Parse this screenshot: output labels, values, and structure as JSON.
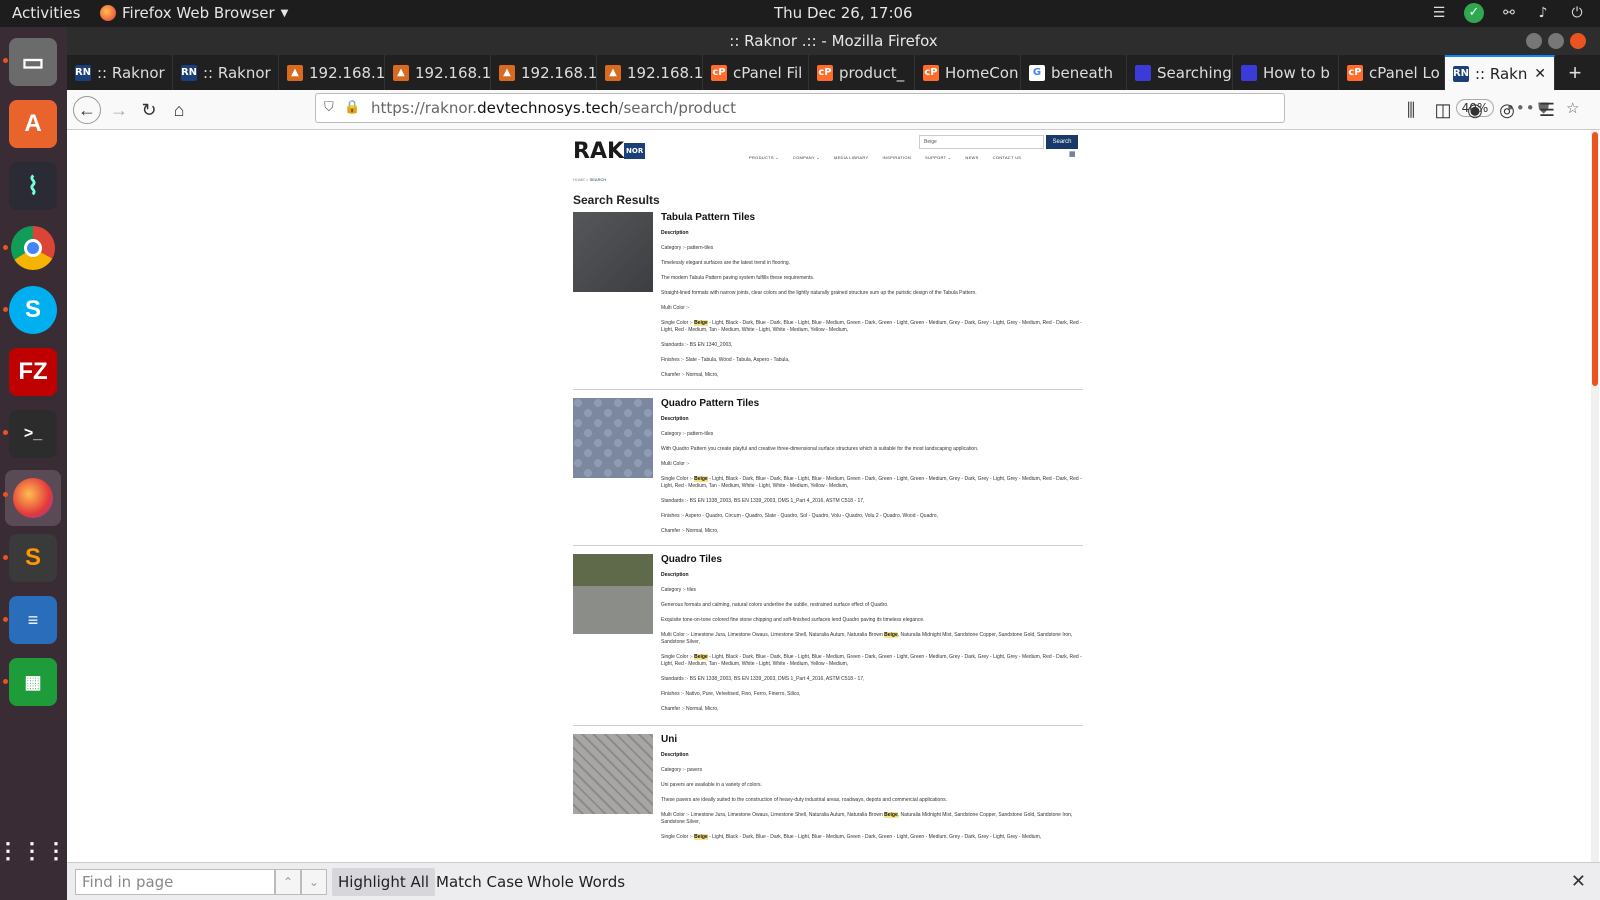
{
  "system": {
    "activities": "Activities",
    "app_menu": "Firefox Web Browser",
    "clock": "Thu Dec 26, 17:06"
  },
  "window": {
    "title": ":: Raknor .:: - Mozilla Firefox"
  },
  "tabs": [
    {
      "label": ":: Raknor",
      "icon": "raknor-icon"
    },
    {
      "label": ":: Raknor",
      "icon": "raknor-icon"
    },
    {
      "label": "192.168.1",
      "icon": "server-icon"
    },
    {
      "label": "192.168.1",
      "icon": "server-icon"
    },
    {
      "label": "192.168.1",
      "icon": "server-icon"
    },
    {
      "label": "192.168.1",
      "icon": "server-icon"
    },
    {
      "label": "cPanel Fil",
      "icon": "cpanel-icon"
    },
    {
      "label": "product_",
      "icon": "cpanel-icon"
    },
    {
      "label": "HomeCon",
      "icon": "cpanel-icon"
    },
    {
      "label": "beneath",
      "icon": "google-icon"
    },
    {
      "label": "Searching",
      "icon": "page-icon"
    },
    {
      "label": "How to b",
      "icon": "page-icon"
    },
    {
      "label": "cPanel Lo",
      "icon": "cpanel-icon"
    },
    {
      "label": ":: Rakn",
      "icon": "raknor-icon",
      "active": true
    }
  ],
  "nav": {
    "url_prefix": "https://raknor.",
    "url_domain": "devtechnosys.tech",
    "url_path": "/search/product",
    "zoom": "40%"
  },
  "site": {
    "logo_text": "RAK",
    "logo_badge": "NOR",
    "search_value": "Beige",
    "search_button": "Search",
    "menu": [
      "PRODUCTS ⌄",
      "COMPANY ⌄",
      "MEDIA LIBRARY",
      "INSPIRATION",
      "SUPPORT ⌄",
      "NEWS",
      "CONTACT US"
    ],
    "breadcrumb_home": "HOME",
    "breadcrumb_sep": ">",
    "breadcrumb_current": "SEARCH",
    "heading": "Search Results",
    "results": [
      {
        "title": "Tabula Pattern Tiles",
        "description_label": "Description",
        "category": "Category :- pattern-tiles",
        "texts": [
          "Timelessly elegant surfaces are the latest trend in flooring.",
          "The modern Tabula Pattern paving system fulfills these requirements.",
          "Straight-lined formats with narrow joints, clear colors and the lightly naturally grained structure sum up the puristic design of the Tabula Pattern."
        ],
        "multi_color": "Multi Color :-",
        "single_color_prefix": "Single Color :-",
        "single_color_hl": "Beige",
        "single_color_rest": "- Light, Black - Dark, Blue - Dark, Blue - Light, Blue - Medium, Green - Dark, Green - Light, Green - Medium, Grey - Dark, Grey - Light, Grey - Medium, Red - Dark, Red - Light, Red - Medium, Tan - Medium, White - Light, White - Medium, Yellow - Medium,",
        "standards": "Standards :- BS EN 1340_2003,",
        "finishes": "Finishes :- Slate - Tabula, Wood - Tabula, Aspero - Tabula,",
        "chamfer": "Chamfer :- Normal, Micro,"
      },
      {
        "title": "Quadro Pattern Tiles",
        "description_label": "Description",
        "category": "Category :- pattern-tiles",
        "texts": [
          "With Quadro Pattern you create playful and creative three-dimensional surface structures which is suitable for the most landscaping application."
        ],
        "multi_color": "Multi Color :-",
        "single_color_prefix": "Single Color :-",
        "single_color_hl": "Beige",
        "single_color_rest": "- Light, Black - Dark, Blue - Dark, Blue - Light, Blue - Medium, Green - Dark, Green - Light, Green - Medium, Grey - Dark, Grey - Light, Grey - Medium, Red - Dark, Red - Light, Red - Medium, Tan - Medium, White - Light, White - Medium, Yellow - Medium,",
        "standards": "Standards :- BS EN 1338_2003, BS EN 1339_2003, DMS 1_Part 4_2016, ASTM C518 - 17,",
        "finishes": "Finishes :- Aspero - Quadro, Circum - Quadro, Slate - Quadro, Sol - Quadro, Volu - Quadro, Volu 2 - Quadro, Wood - Quadro,",
        "chamfer": "Chamfer :- Normal, Micro,"
      },
      {
        "title": "Quadro Tiles",
        "description_label": "Description",
        "category": "Category :- tiles",
        "texts": [
          "Generous formats and calming, natural colors underline the subtle, restrained surface effect of Quadro.",
          "Exquisite tone-on-tone colored fine stone chipping and soft-finished surfaces lend Quadro paving its timeless elegance."
        ],
        "multi_color": "Multi Color :- Limestone Jura, Limestone Owaus, Limestone Shell, Naturalia Autum, Naturalia Brown",
        "multi_color_hl": "Beige",
        "multi_color_rest": ", Naturalia Midnight Mist, Sandstone Copper, Sandstone Gold, Sandstone Iron, Sandstone Silver,",
        "single_color_prefix": "Single Color :-",
        "single_color_hl": "Beige",
        "single_color_rest": "- Light, Black - Dark, Blue - Dark, Blue - Light, Blue - Medium, Green - Dark, Green - Light, Green - Medium, Grey - Dark, Grey - Light, Grey - Medium, Red - Dark, Red - Light, Red - Medium, Tan - Medium, White - Light, White - Medium, Yellow - Medium,",
        "standards": "Standards :- BS EN 1338_2003, BS EN 1339_2003, DMS 1_Part 4_2016, ASTM C518 - 17,",
        "finishes": "Finishes :- Nativo, Pure, Velvetised, Fino, Ferro, Finerro, Silico,",
        "chamfer": "Chamfer :- Normal, Micro,"
      },
      {
        "title": "Uni",
        "description_label": "Description",
        "category": "Category :- pavers",
        "texts": [
          "Uni pavers are available in a variety of colors.",
          "These pavers are ideally suited to the construction of heavy-duty industrial areas, roadways, depots and commercial applications."
        ],
        "multi_color": "Multi Color :- Limestone Jura, Limestone Owaus, Limestone Shell, Naturalia Autum, Naturalia Brown",
        "multi_color_hl": "Beige",
        "multi_color_rest": ", Naturalia Midnight Mist, Sandstone Copper, Sandstone Gold, Sandstone Iron, Sandstone Silver,",
        "single_color_prefix": "Single Color :-",
        "single_color_hl": "Beige",
        "single_color_rest": "- Light, Black - Dark, Blue - Dark, Blue - Light, Blue - Medium, Green - Dark, Green - Light, Green - Medium, Grey - Dark, Grey - Light, Grey - Medium,"
      }
    ]
  },
  "findbar": {
    "placeholder": "Find in page",
    "highlight_all": "Highlight All",
    "match_case": "Match Case",
    "whole_words": "Whole Words"
  },
  "colors": {
    "accent": "#e95420",
    "brand": "#173a6b",
    "highlight": "#f4e58a"
  }
}
